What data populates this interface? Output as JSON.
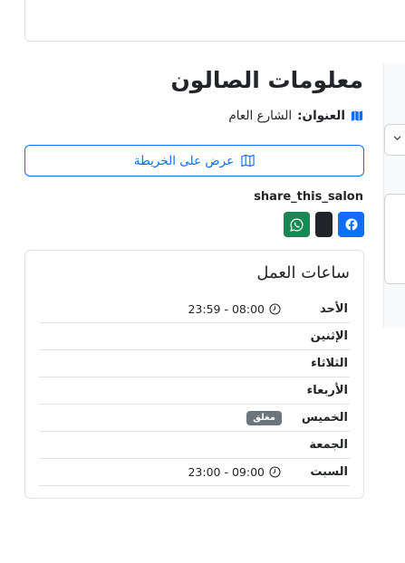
{
  "salon": {
    "title": "معلومات الصالون",
    "address_label": "العنوان:",
    "address_value": "الشارع العام",
    "map_button_label": "عرض على الخريطة"
  },
  "share": {
    "label": "share_this_salon",
    "buttons": [
      "facebook-icon",
      "x-icon",
      "whatsapp-icon"
    ]
  },
  "hours": {
    "title": "ساعات العمل",
    "rows": [
      {
        "day": "الأحد",
        "time": "23:59 - 08:00",
        "status": ""
      },
      {
        "day": "الإثنين",
        "time": "",
        "status": ""
      },
      {
        "day": "الثلاثاء",
        "time": "",
        "status": ""
      },
      {
        "day": "الأربعاء",
        "time": "",
        "status": ""
      },
      {
        "day": "الخميس",
        "time": "",
        "status": "مغلق"
      },
      {
        "day": "الجمعة",
        "time": "",
        "status": ""
      },
      {
        "day": "السبت",
        "time": "23:00 - 09:00",
        "status": ""
      }
    ]
  },
  "colors": {
    "primary": "#0d6efd",
    "facebook": "#0d6efd",
    "x": "#212529",
    "whatsapp": "#198754",
    "badge": "#6c757d"
  }
}
